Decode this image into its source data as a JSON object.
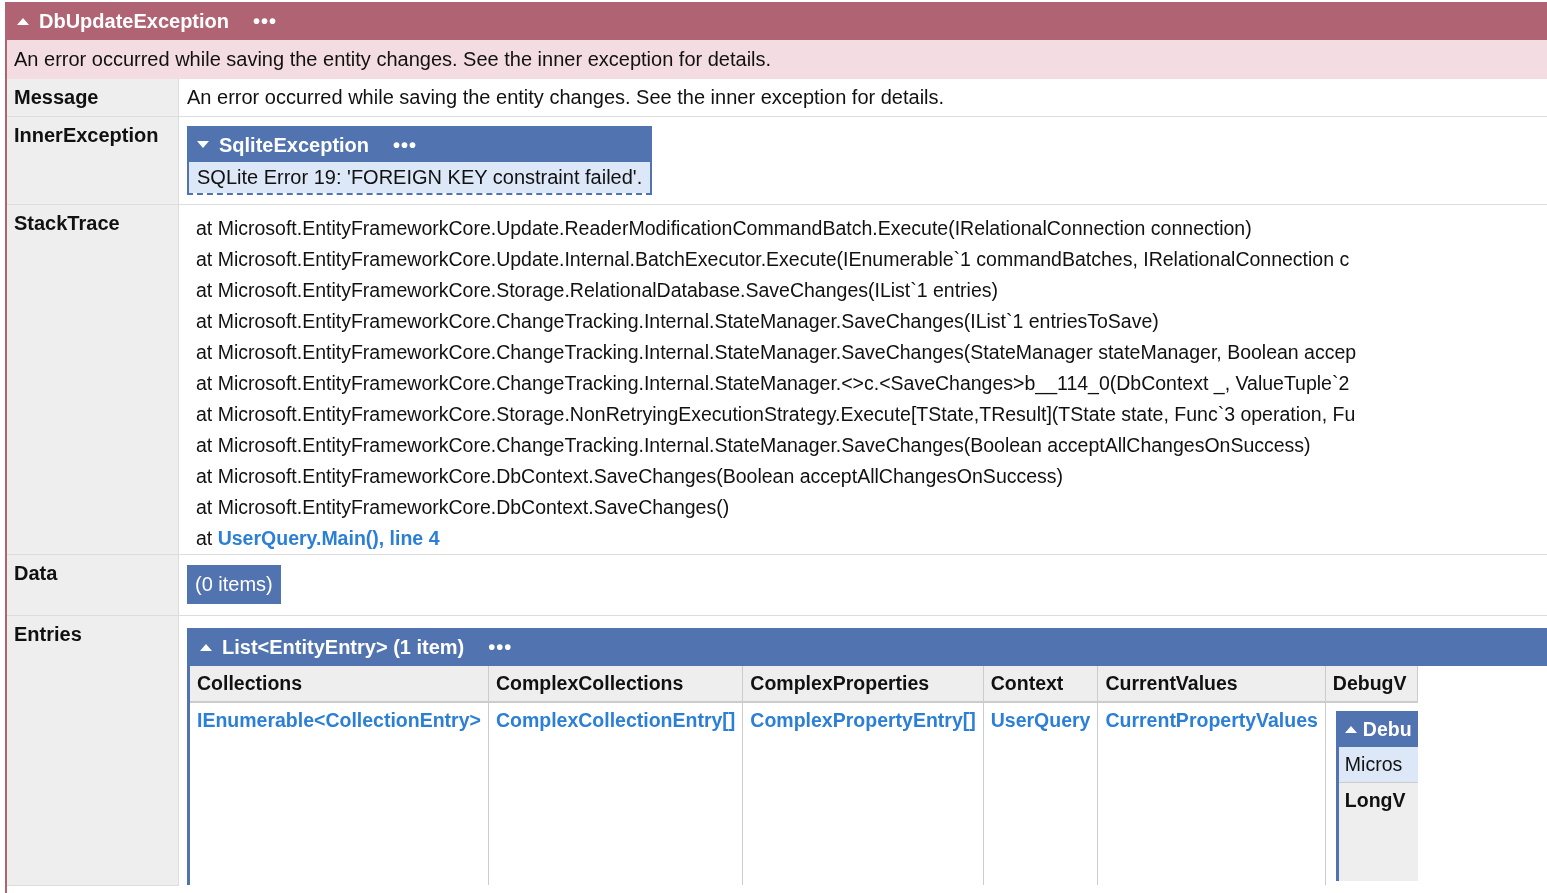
{
  "exception": {
    "title": "DbUpdateException",
    "expanded": true,
    "more": "•••",
    "summary": "An error occurred while saving the entity changes. See the inner exception for details.",
    "properties": [
      {
        "kind": "text",
        "name": "Message",
        "value": "An error occurred while saving the entity changes. See the inner exception for details."
      },
      {
        "kind": "object",
        "name": "InnerException",
        "title": "SqliteException",
        "expanded": false,
        "more": "•••",
        "summary": "SQLite Error 19: 'FOREIGN KEY constraint failed'."
      },
      {
        "kind": "stack",
        "name": "StackTrace",
        "lines": [
          {
            "kind": "frame",
            "text": "at Microsoft.EntityFrameworkCore.Update.ReaderModificationCommandBatch.Execute(IRelationalConnection connection)"
          },
          {
            "kind": "frame",
            "text": "at Microsoft.EntityFrameworkCore.Update.Internal.BatchExecutor.Execute(IEnumerable`1 commandBatches, IRelationalConnection c"
          },
          {
            "kind": "frame",
            "text": "at Microsoft.EntityFrameworkCore.Storage.RelationalDatabase.SaveChanges(IList`1 entries)"
          },
          {
            "kind": "frame",
            "text": "at Microsoft.EntityFrameworkCore.ChangeTracking.Internal.StateManager.SaveChanges(IList`1 entriesToSave)"
          },
          {
            "kind": "frame",
            "text": "at Microsoft.EntityFrameworkCore.ChangeTracking.Internal.StateManager.SaveChanges(StateManager stateManager, Boolean accep"
          },
          {
            "kind": "frame",
            "text": "at Microsoft.EntityFrameworkCore.ChangeTracking.Internal.StateManager.<>c.<SaveChanges>b__114_0(DbContext _, ValueTuple`2"
          },
          {
            "kind": "frame",
            "text": "at Microsoft.EntityFrameworkCore.Storage.NonRetryingExecutionStrategy.Execute[TState,TResult](TState state, Func`3 operation, Fu"
          },
          {
            "kind": "frame",
            "text": "at Microsoft.EntityFrameworkCore.ChangeTracking.Internal.StateManager.SaveChanges(Boolean acceptAllChangesOnSuccess)"
          },
          {
            "kind": "frame",
            "text": "at Microsoft.EntityFrameworkCore.DbContext.SaveChanges(Boolean acceptAllChangesOnSuccess)"
          },
          {
            "kind": "frame",
            "text": "at Microsoft.EntityFrameworkCore.DbContext.SaveChanges()"
          },
          {
            "kind": "link",
            "prefix": "at",
            "link": "UserQuery.Main(), line 4"
          }
        ]
      },
      {
        "kind": "badge",
        "name": "Data",
        "value": "(0 items)"
      },
      {
        "kind": "table",
        "name": "Entries",
        "title": "List<EntityEntry> (1 item)",
        "expanded": true,
        "more": "•••",
        "columns": [
          "Collections",
          "ComplexCollections",
          "ComplexProperties",
          "Context",
          "CurrentValues",
          "DebugV"
        ],
        "rows": [
          [
            {
              "kind": "link",
              "text": "IEnumerable<CollectionEntry>"
            },
            {
              "kind": "link",
              "text": "ComplexCollectionEntry[]"
            },
            {
              "kind": "link",
              "text": "ComplexPropertyEntry[]"
            },
            {
              "kind": "link",
              "text": "UserQuery"
            },
            {
              "kind": "link",
              "text": "CurrentPropertyValues"
            },
            {
              "kind": "object",
              "title": "Debu",
              "expanded": true,
              "summary": "Micros",
              "properties": [
                "LongV"
              ]
            }
          ]
        ]
      }
    ]
  }
}
